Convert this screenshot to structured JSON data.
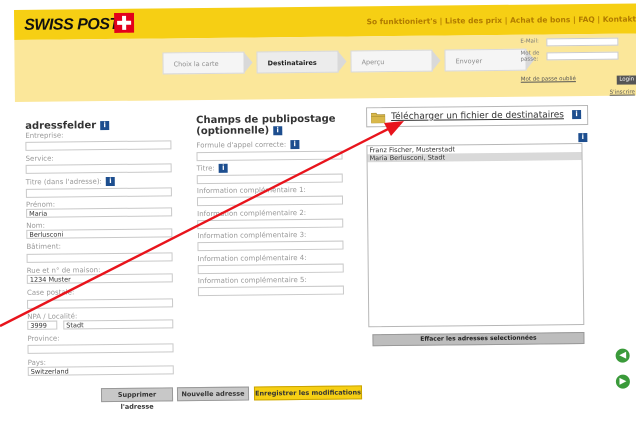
{
  "header": {
    "logo": "SWISS POST",
    "nav": [
      "So funktioniert's",
      "Liste des prix",
      "Achat de bons",
      "FAQ",
      "Kontakt"
    ],
    "nav_sep": " | "
  },
  "wizard": {
    "steps": [
      "Choix la carte",
      "Destinataires",
      "Aperçu",
      "Envoyer"
    ],
    "active_step": "Destinataires"
  },
  "login": {
    "email_label": "E-Mail:",
    "password_label": "Mot de passe:",
    "forgot": "Mot de passe oublié",
    "login_btn": "Login",
    "register": "S'inscrire"
  },
  "address": {
    "title": "adressfelder",
    "fields": [
      {
        "label": "Entreprise:",
        "value": ""
      },
      {
        "label": "Service:",
        "value": ""
      },
      {
        "label": "Titre (dans l'adresse):",
        "value": ""
      },
      {
        "label": "Prénom:",
        "value": "Maria"
      },
      {
        "label": "Nom:",
        "value": "Berlusconi"
      },
      {
        "label": "Bâtiment:",
        "value": ""
      },
      {
        "label": "Rue et n° de maison:",
        "value": "1234 Muster"
      },
      {
        "label": "Case postale:",
        "value": ""
      },
      {
        "label": "NPA / Localité:",
        "value": "3999",
        "value2": "Stadt"
      },
      {
        "label": "Province:",
        "value": ""
      },
      {
        "label": "Pays:",
        "value": "Switzerland"
      }
    ]
  },
  "mailing": {
    "title_line1": "Champs de publipostage",
    "title_line2": "(optionnelle)",
    "fields": [
      "Formule d'appel correcte:",
      "Titre:",
      "Information complémentaire 1:",
      "Information complémentaire 2:",
      "Information complémentaire 3:",
      "Information complémentaire 4:",
      "Information complémentaire 5:"
    ]
  },
  "recipients": {
    "upload_link": "Télécharger un fichier de destinataires",
    "list": [
      {
        "name": "Franz Fischer, Musterstadt",
        "selected": false
      },
      {
        "name": "Maria Berlusconi, Stadt",
        "selected": true
      }
    ],
    "delete_selected": "Effacer les adresses selectionnées"
  },
  "actions": {
    "delete": "Supprimer l'adresse",
    "new": "Nouvelle adresse",
    "save": "Enregistrer les modifications"
  },
  "info_glyph": "i",
  "colors": {
    "brand_yellow": "#f6cf14",
    "info_blue": "#1d4e8f",
    "annotation_red": "#e8141c"
  }
}
